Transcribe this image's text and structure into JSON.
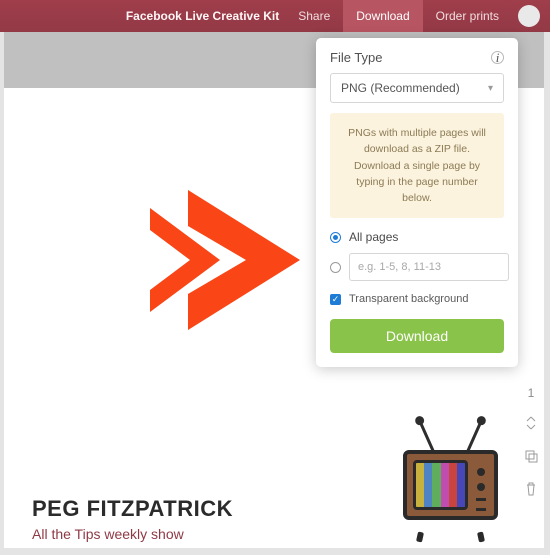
{
  "header": {
    "title": "Facebook Live Creative Kit",
    "tabs": {
      "share": "Share",
      "download": "Download",
      "order": "Order prints"
    }
  },
  "download_panel": {
    "heading": "File Type",
    "select_value": "PNG (Recommended)",
    "note": "PNGs with multiple pages will download as a ZIP file. Download a single page by typing in the page number below.",
    "all_pages_label": "All pages",
    "pages_placeholder": "e.g. 1-5, 8, 11-13",
    "transparent_label": "Transparent background",
    "button_label": "Download"
  },
  "design": {
    "name": "PEG FITZPATRICK",
    "subtitle": "All the Tips weekly show"
  },
  "side": {
    "page_number": "1"
  }
}
